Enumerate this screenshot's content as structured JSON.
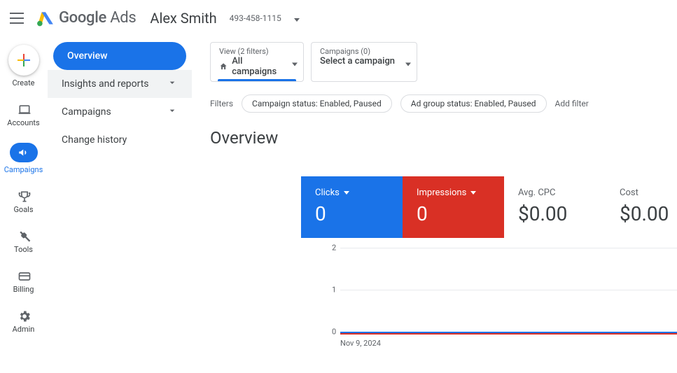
{
  "header": {
    "brand_google": "Google",
    "brand_ads": "Ads",
    "account_name": "Alex Smith",
    "account_id": "493-458-1115"
  },
  "rail": {
    "create": "Create",
    "accounts": "Accounts",
    "campaigns": "Campaigns",
    "goals": "Goals",
    "tools": "Tools",
    "billing": "Billing",
    "admin": "Admin"
  },
  "sidenav": {
    "overview": "Overview",
    "insights": "Insights and reports",
    "campaigns": "Campaigns",
    "change_history": "Change history"
  },
  "selectors": {
    "view_label": "View (2 filters)",
    "view_value": "All campaigns",
    "camp_label": "Campaigns (0)",
    "camp_value": "Select a campaign"
  },
  "filters": {
    "label": "Filters",
    "chip1": "Campaign status: Enabled, Paused",
    "chip2": "Ad group status: Enabled, Paused",
    "add": "Add filter"
  },
  "page": {
    "title": "Overview"
  },
  "metrics": {
    "clicks_label": "Clicks",
    "clicks_value": "0",
    "impr_label": "Impressions",
    "impr_value": "0",
    "cpc_label": "Avg. CPC",
    "cpc_value": "$0.00",
    "cost_label": "Cost",
    "cost_value": "$0.00"
  },
  "chart_data": {
    "type": "line",
    "x": [
      "Nov 9, 2024"
    ],
    "series": [
      {
        "name": "Clicks",
        "values": [
          0
        ],
        "color": "#1a73e8"
      },
      {
        "name": "Impressions",
        "values": [
          0
        ],
        "color": "#d93025"
      }
    ],
    "ylim": [
      0,
      2
    ],
    "yticks": [
      0,
      1,
      2
    ],
    "xlabel_first": "Nov 9, 2024"
  }
}
